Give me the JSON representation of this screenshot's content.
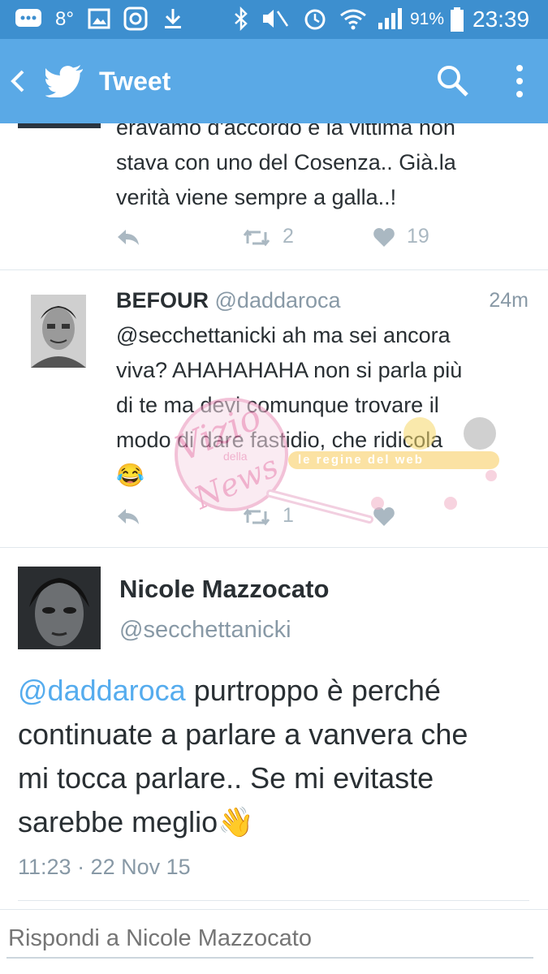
{
  "statusbar": {
    "battery_pct": "91%",
    "time": "23:39",
    "notif_count": "8°"
  },
  "appbar": {
    "back_icon": "chevron-left-icon",
    "logo_icon": "twitter-bird-icon",
    "title": "Tweet",
    "search_icon": "search-icon",
    "more_icon": "more-vertical-icon"
  },
  "tweet1": {
    "lines": [
      "eravamo d'accordo e la vittima non",
      "stava con uno del Cosenza.. Già.la",
      "verità viene sempre a galla..!"
    ],
    "retweets": "2",
    "likes": "19"
  },
  "tweet2": {
    "name": "BEFOUR",
    "handle": "@daddaroca",
    "time": "24m",
    "lines": [
      "@secchettanicki ah ma sei ancora",
      "viva? AHAHAHAHA non si parla più",
      "di te ma devi comunque trovare il",
      "modo di dare fastidio, che ridicola"
    ],
    "emoji": "😂",
    "retweets": "1"
  },
  "watermark": {
    "text1": "Vizio",
    "text2": "della",
    "text3": "News",
    "tagline": "le regine del web"
  },
  "main_tweet": {
    "name": "Nicole Mazzocato",
    "handle": "@secchettanicki",
    "mention": "@daddaroca",
    "line1_rest": " purtroppo è perché",
    "line2": "continuate a parlare a vanvera che",
    "line3": "mi tocca parlare.. Se mi evitaste",
    "line4": "sarebbe meglio",
    "emoji": "👋",
    "timestamp": "11:23 · 22 Nov 15"
  },
  "reply": {
    "placeholder": "Rispondi a Nicole Mazzocato"
  },
  "colors": {
    "status_bar": "#3d8fcf",
    "app_bar": "#5aa9e6",
    "link": "#55acee",
    "muted": "#aab8c2"
  }
}
